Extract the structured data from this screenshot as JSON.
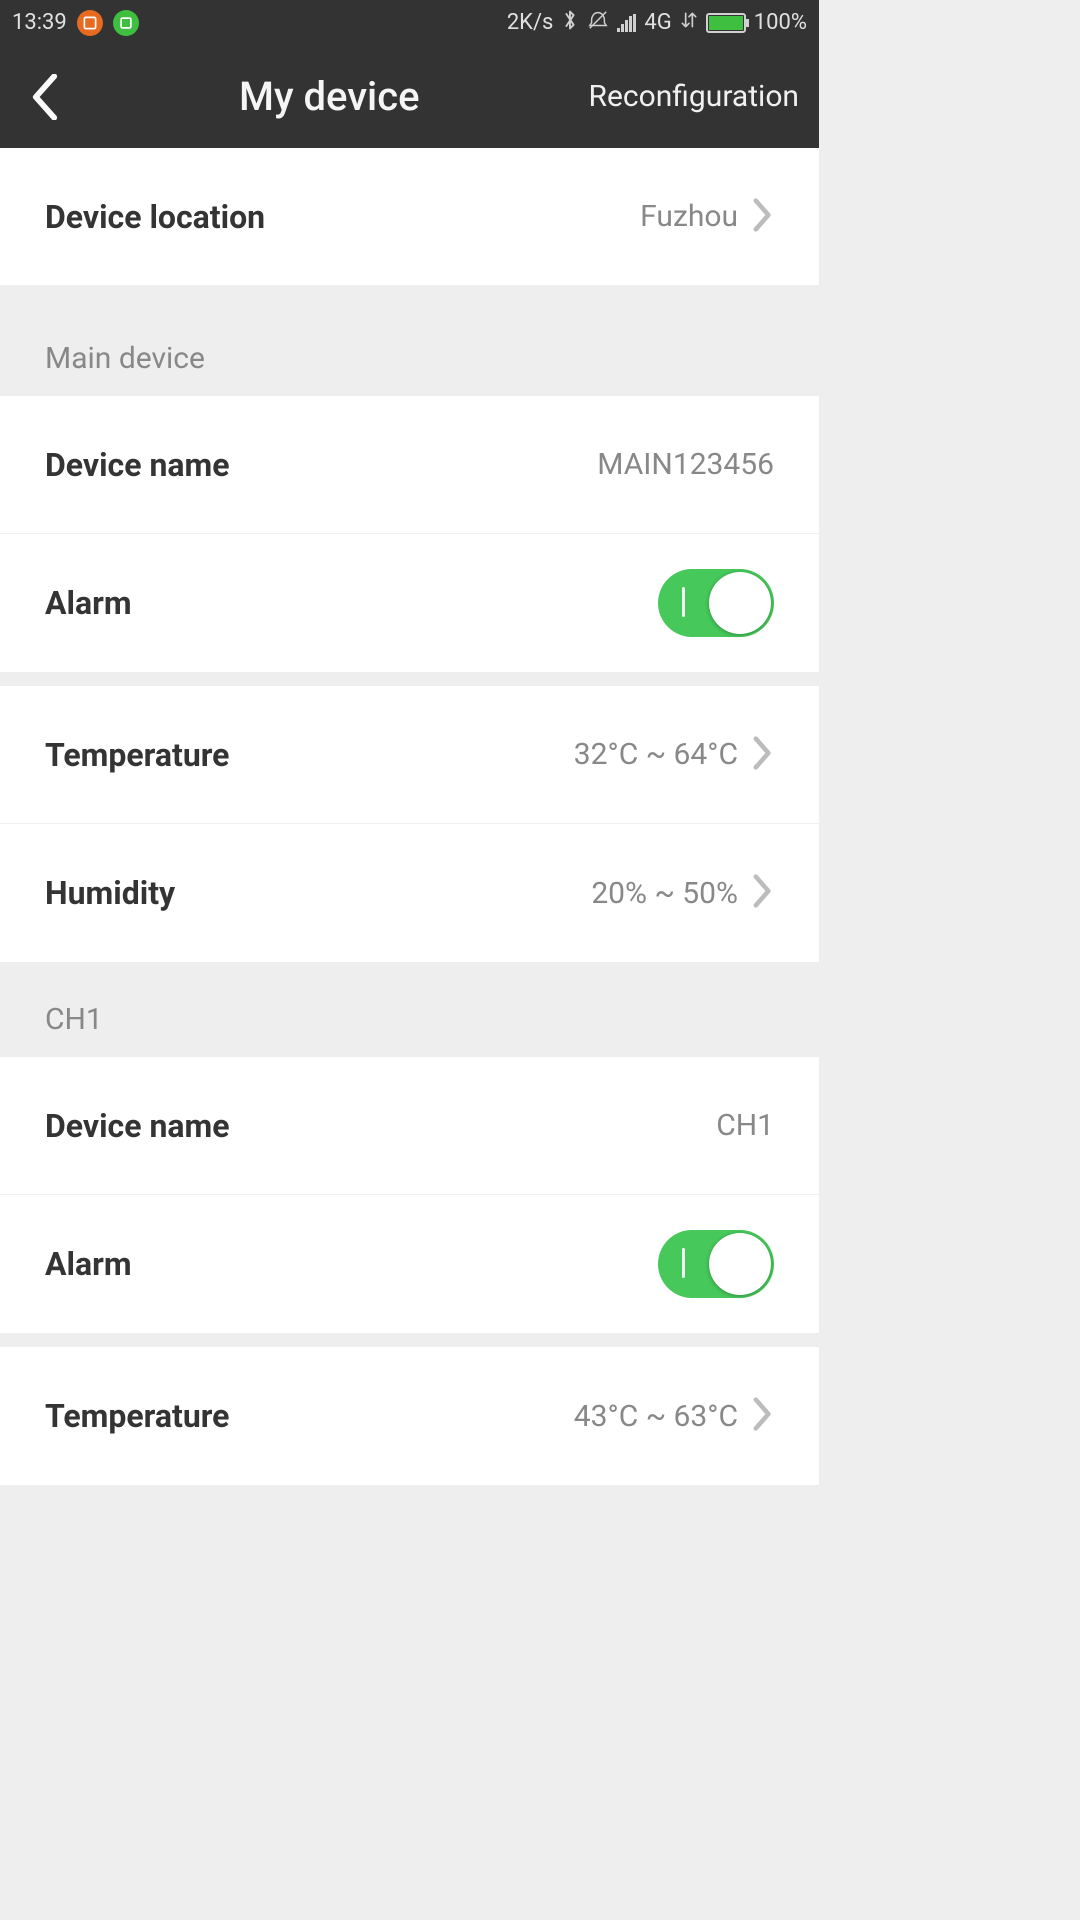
{
  "statusbar": {
    "time": "13:39",
    "net_speed": "2K/s",
    "net_type": "4G",
    "battery_pct": "100%"
  },
  "nav": {
    "title": "My device",
    "action": "Reconfiguration"
  },
  "location_row": {
    "label": "Device location",
    "value": "Fuzhou"
  },
  "sections": [
    {
      "header": "Main device",
      "device_name_label": "Device name",
      "device_name_value": "MAIN123456",
      "alarm_label": "Alarm",
      "alarm_on": true,
      "temperature_label": "Temperature",
      "temperature_value": "32°C ~ 64°C",
      "humidity_label": "Humidity",
      "humidity_value": "20% ~ 50%"
    },
    {
      "header": "CH1",
      "device_name_label": "Device name",
      "device_name_value": "CH1",
      "alarm_label": "Alarm",
      "alarm_on": true,
      "temperature_label": "Temperature",
      "temperature_value": "43°C ~ 63°C"
    }
  ]
}
